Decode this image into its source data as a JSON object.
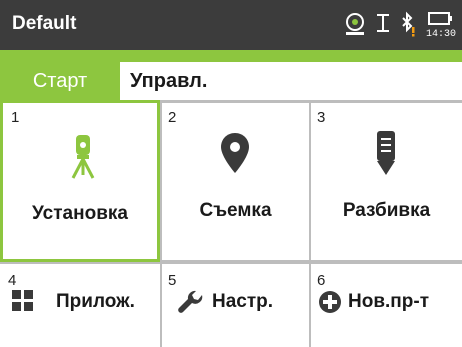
{
  "header": {
    "title": "Default",
    "time": "14:30"
  },
  "tabs": [
    {
      "label": "Старт",
      "active": true
    },
    {
      "label": "Управл.",
      "active": false
    }
  ],
  "tiles": [
    {
      "number": "1",
      "label": "Установка",
      "icon": "tripod-instrument-icon",
      "selected": true
    },
    {
      "number": "2",
      "label": "Съемка",
      "icon": "map-pin-icon",
      "selected": false
    },
    {
      "number": "3",
      "label": "Разбивка",
      "icon": "stakeout-marker-icon",
      "selected": false
    },
    {
      "number": "4",
      "label": "Прилож.",
      "icon": "apps-grid-icon",
      "selected": false
    },
    {
      "number": "5",
      "label": "Настр.",
      "icon": "wrench-icon",
      "selected": false
    },
    {
      "number": "6",
      "label": "Нов.пр-т",
      "icon": "plus-circle-icon",
      "selected": false
    }
  ],
  "colors": {
    "accent": "#8dc63f",
    "titlebar": "#3c3c3c",
    "icon_dark": "#3a3a3a",
    "warning": "#f39c12"
  }
}
